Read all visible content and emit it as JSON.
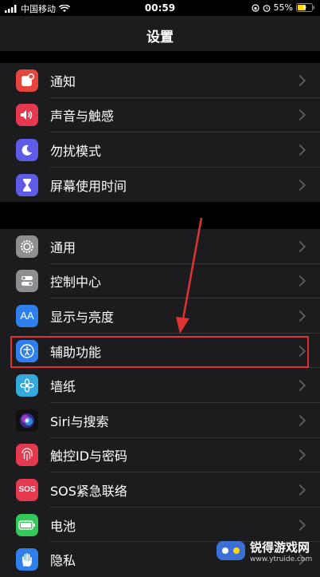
{
  "status": {
    "carrier": "中国移动",
    "time": "00:59",
    "battery": "55%"
  },
  "header": {
    "title": "设置"
  },
  "groups": [
    {
      "items": [
        {
          "label": "通知",
          "icon": "notifications-icon",
          "color": "#e5453d"
        },
        {
          "label": "声音与触感",
          "icon": "sounds-icon",
          "color": "#e5394f"
        },
        {
          "label": "勿扰模式",
          "icon": "do-not-disturb-icon",
          "color": "#5e5ce6"
        },
        {
          "label": "屏幕使用时间",
          "icon": "screen-time-icon",
          "color": "#5e5ce6"
        }
      ]
    },
    {
      "items": [
        {
          "label": "通用",
          "icon": "gear-icon",
          "color": "#8e8e93"
        },
        {
          "label": "控制中心",
          "icon": "control-center-icon",
          "color": "#8e8e93"
        },
        {
          "label": "显示与亮度",
          "icon": "display-brightness-icon",
          "color": "#2f80ed"
        },
        {
          "label": "辅助功能",
          "icon": "accessibility-icon",
          "color": "#2f80ed"
        },
        {
          "label": "墙纸",
          "icon": "wallpaper-icon",
          "color": "#34aadc"
        },
        {
          "label": "Siri与搜索",
          "icon": "siri-icon",
          "color": "#111111"
        },
        {
          "label": "触控ID与密码",
          "icon": "touch-id-icon",
          "color": "#e5394f"
        },
        {
          "label": "SOS紧急联络",
          "icon": "sos-icon",
          "color": "#e5394f"
        },
        {
          "label": "电池",
          "icon": "battery-icon",
          "color": "#34c759"
        },
        {
          "label": "隐私",
          "icon": "privacy-hand-icon",
          "color": "#2f80ed"
        }
      ]
    }
  ],
  "watermark": {
    "name": "锐得游戏网",
    "url": "www.ytruide.com"
  },
  "colors": {
    "highlight": "#e03232",
    "background": "#000000",
    "cell": "#1c1c1e"
  }
}
